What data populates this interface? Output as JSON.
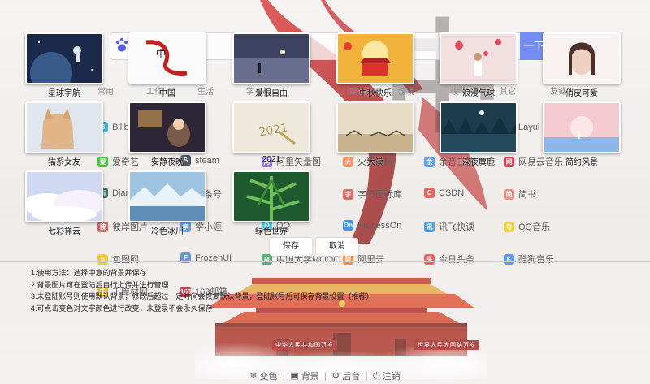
{
  "search": {
    "button_label": "一下"
  },
  "bg_tabs": [
    "常用",
    "工作",
    "生活",
    "学习",
    "娱乐",
    "游戏",
    "设计",
    "其它",
    "友链"
  ],
  "bg_sites": [
    {
      "label": "Bilibili",
      "icon": "bilibili-icon",
      "color": "#00a1d6",
      "glyph": "B"
    },
    {
      "label": "宝",
      "icon": "taobao-icon",
      "color": "#ff5000",
      "glyph": "宝"
    },
    {
      "label": "Layui",
      "icon": "layui-icon",
      "color": "#16b777",
      "glyph": "L"
    },
    {
      "label": "爱奇艺",
      "icon": "iqiyi-icon",
      "color": "#00be06",
      "glyph": "爱"
    },
    {
      "label": "steam",
      "icon": "steam-icon",
      "color": "#1b2838",
      "glyph": "S"
    },
    {
      "label": "阿里矢量图",
      "icon": "iconfont-icon",
      "color": "#7c4dff",
      "glyph": "阿"
    },
    {
      "label": "火狐官网",
      "icon": "firefox-icon",
      "color": "#ff7139",
      "glyph": "火"
    },
    {
      "label": "余音工坊",
      "icon": "yuyin-icon",
      "color": "#2b8be6",
      "glyph": "余"
    },
    {
      "label": "网易云音乐",
      "icon": "netease-music-icon",
      "color": "#e60026",
      "glyph": "网"
    },
    {
      "label": "Django",
      "icon": "django-icon",
      "color": "#0c4b33",
      "glyph": "dj"
    },
    {
      "label": "头条号",
      "icon": "toutiao-icon",
      "color": "#e8382f",
      "glyph": "头"
    },
    {
      "label": "字节图标库",
      "icon": "iconpark-icon",
      "color": "#e8382f",
      "glyph": "字"
    },
    {
      "label": "CSDN",
      "icon": "csdn-icon",
      "color": "#e8382f",
      "glyph": "C"
    },
    {
      "label": "简书",
      "icon": "jianshu-icon",
      "color": "#ea6f5a",
      "glyph": "简"
    },
    {
      "label": "彼岸图片",
      "icon": "netbian-icon",
      "color": "#c0392b",
      "glyph": "彼"
    },
    {
      "label": "学小涯",
      "icon": "xuexiaoya-icon",
      "color": "#2e86de",
      "glyph": "学"
    },
    {
      "label": "QQ",
      "icon": "qq-icon",
      "color": "#12b7f5",
      "glyph": "Q"
    },
    {
      "label": "ProcessOn",
      "icon": "processon-icon",
      "color": "#067bef",
      "glyph": "On"
    },
    {
      "label": "讯飞快读",
      "icon": "xunfei-icon",
      "color": "#1e88e5",
      "glyph": "讯"
    },
    {
      "label": "QQ音乐",
      "icon": "qqmusic-icon",
      "color": "#f5c400",
      "glyph": "Q"
    },
    {
      "label": "包图网",
      "icon": "ibaotu-icon",
      "color": "#f7b500",
      "glyph": "b"
    },
    {
      "label": "FrozenUI",
      "icon": "frozenui-icon",
      "color": "#3a7bd5",
      "glyph": "F"
    },
    {
      "label": "中国大学MOOC",
      "icon": "mooc-icon",
      "color": "#2a9d4a",
      "glyph": "M"
    },
    {
      "label": "阿里云",
      "icon": "aliyun-icon",
      "color": "#ff6a00",
      "glyph": "阿"
    },
    {
      "label": "今日头条",
      "icon": "toutiao-news-icon",
      "color": "#e8382f",
      "glyph": "头"
    },
    {
      "label": "酷狗音乐",
      "icon": "kugou-icon",
      "color": "#2a7fff",
      "glyph": "K"
    },
    {
      "label": "千库材网",
      "icon": "588ku-icon",
      "color": "#e0b100",
      "glyph": "千"
    },
    {
      "label": "163邮箱",
      "icon": "mail163-icon",
      "color": "#d0021b",
      "glyph": "163"
    },
    {
      "label": "超能搜",
      "icon": "chaonengsou-icon",
      "color": "#4e6ef2",
      "glyph": "超"
    }
  ],
  "gate": {
    "left_banner": "中华人民共和国万岁",
    "right_banner": "世界人民大团结万岁"
  },
  "wallpapers": [
    {
      "label": "星球宇航"
    },
    {
      "label": "中国"
    },
    {
      "label": "爱恨自由"
    },
    {
      "label": "中秋快乐"
    },
    {
      "label": "浪漫气球"
    },
    {
      "label": "俏皮可爱"
    },
    {
      "label": "猫系女友"
    },
    {
      "label": "安静夜晚"
    },
    {
      "label": "2021"
    },
    {
      "label": "大漠"
    },
    {
      "label": "深夜麋鹿"
    },
    {
      "label": "简约风景"
    },
    {
      "label": "七彩祥云"
    },
    {
      "label": "冷色冰川"
    },
    {
      "label": "绿色世界"
    }
  ],
  "buttons": {
    "save": "保存",
    "cancel": "取消"
  },
  "instructions": [
    "1.使用方法：选择中意的背景并保存",
    "2.背景图片可在登陆后自行上传并进行管理",
    "3.未登陆账号则使用默认背景，修改后超过一定时间会恢复默认背景，登陆账号后可保存背景设置（推荐）",
    "4.可点击变色对文字颜色进行改变，未登录不会永久保存"
  ],
  "menu": [
    {
      "label": "变色",
      "icon": "snowflake-icon",
      "glyph": "❄"
    },
    {
      "label": "背景",
      "icon": "image-icon",
      "glyph": "▣"
    },
    {
      "label": "后台",
      "icon": "gear-icon",
      "glyph": "⚙"
    },
    {
      "label": "注销",
      "icon": "power-icon",
      "glyph": "⏻"
    }
  ]
}
